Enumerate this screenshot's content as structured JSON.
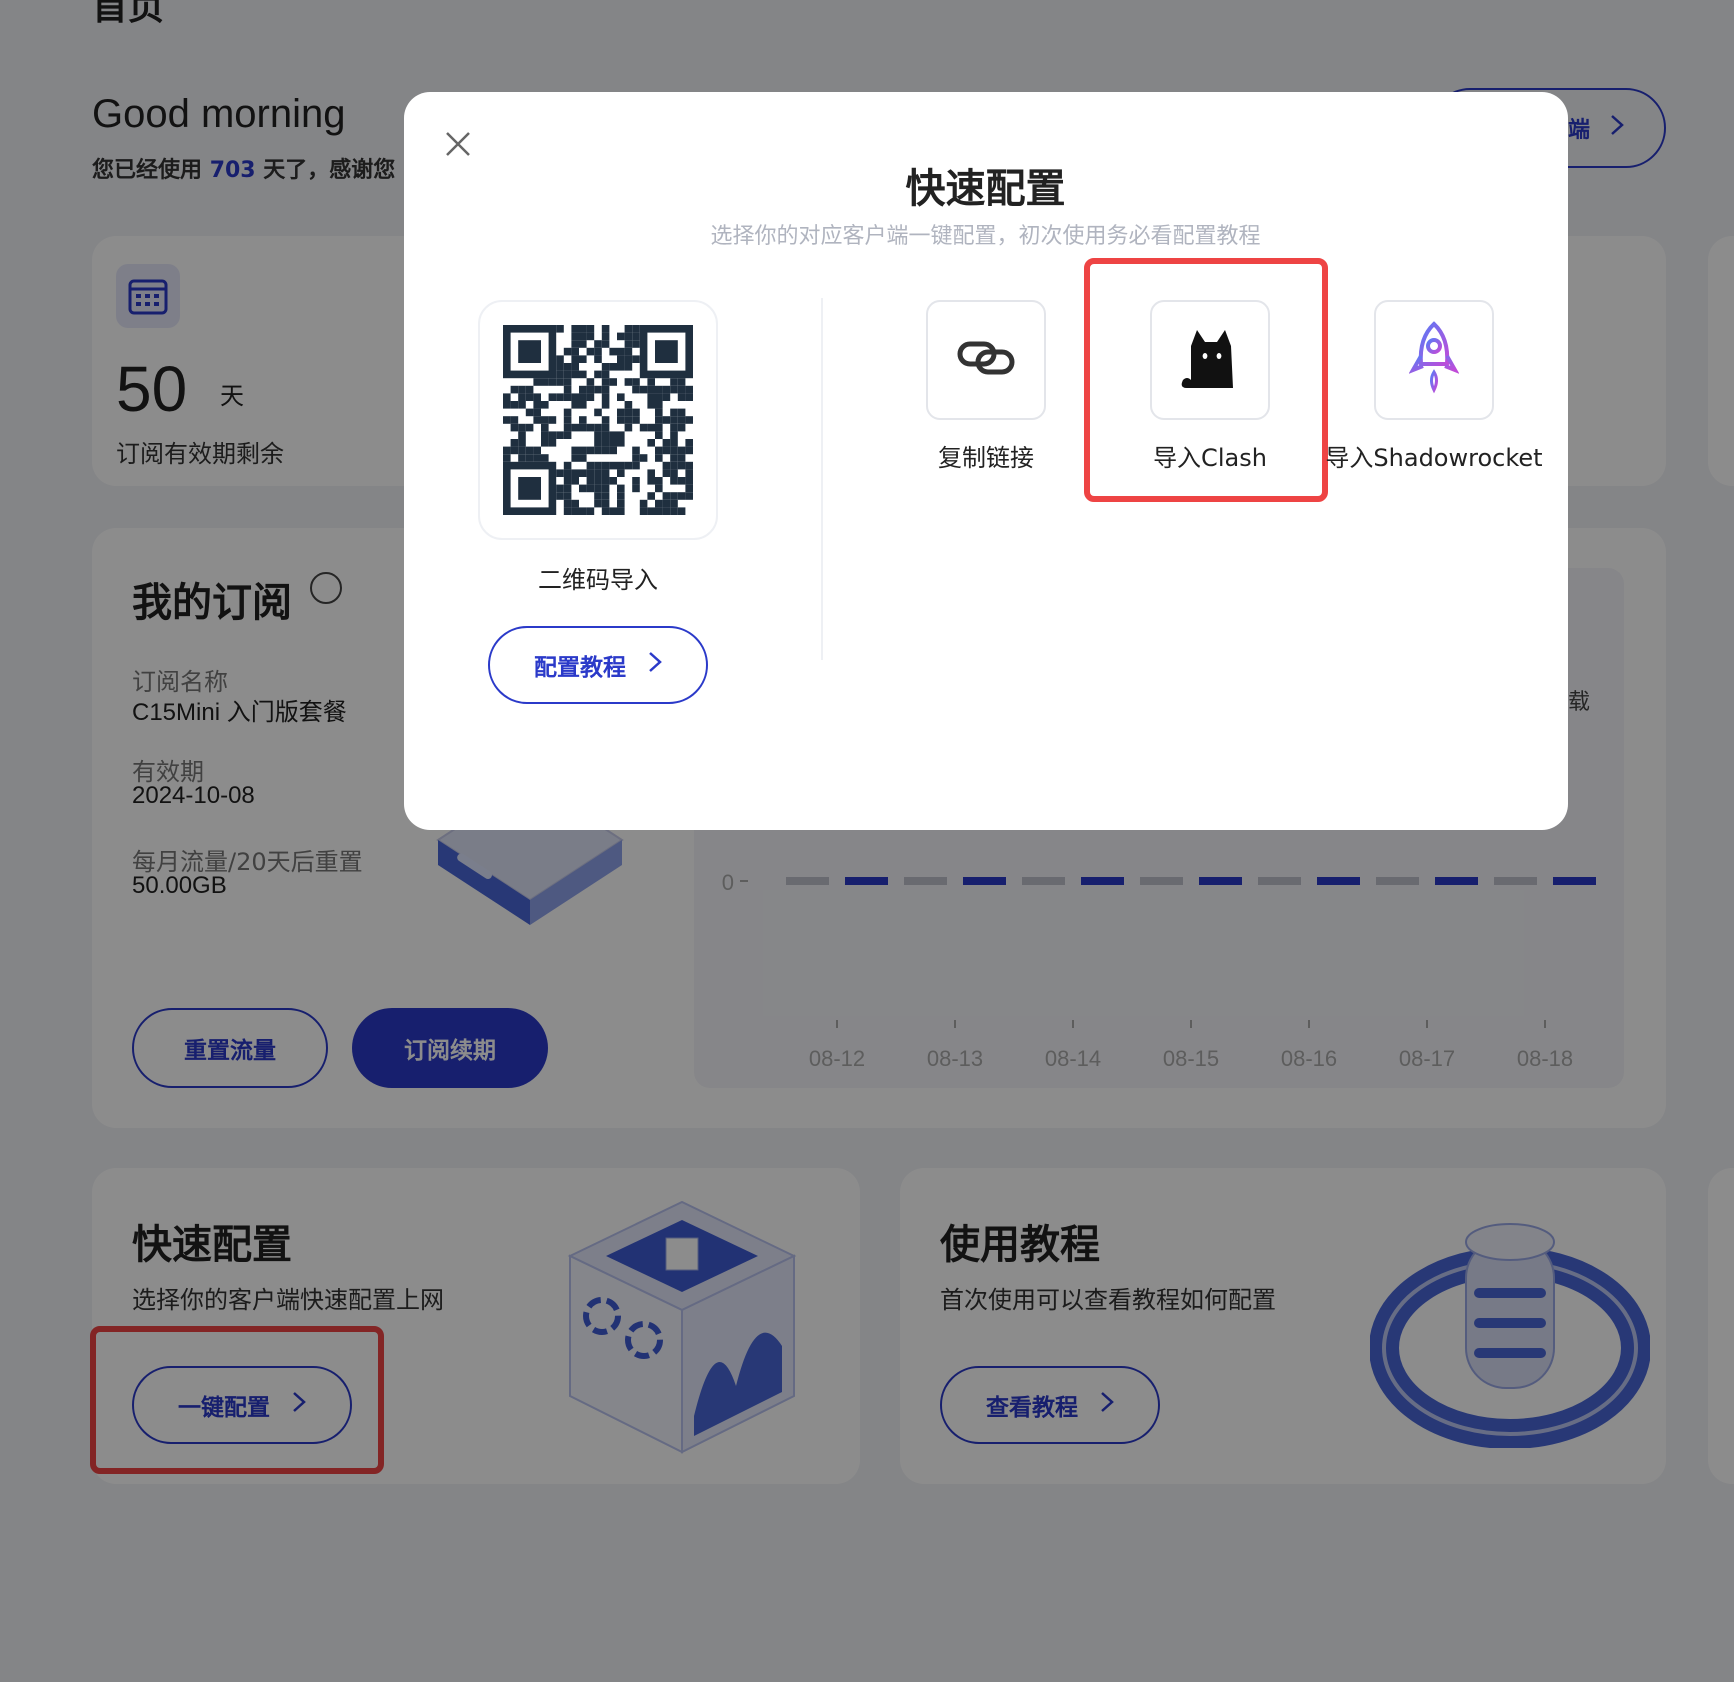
{
  "page": {
    "title": "首页",
    "greeting": "Good morning",
    "usage_prefix": "您已经使用",
    "usage_days": "703",
    "usage_suffix": "天了，感谢您",
    "client_button": "端"
  },
  "remaining": {
    "days": "50",
    "unit": "天",
    "label": "订阅有效期剩余"
  },
  "subscription": {
    "title": "我的订阅",
    "name_label": "订阅名称",
    "name_value": "C15Mini 入门版套餐",
    "expiry_label": "有效期",
    "expiry_value": "2024-10-08",
    "traffic_label": "每月流量/20天后重置",
    "traffic_value": "50.00GB",
    "reset_button": "重置流量",
    "renew_button": "订阅续期"
  },
  "traffic_chart": {
    "side_label": "载",
    "y_zero": "0"
  },
  "chart_data": {
    "type": "bar",
    "categories": [
      "08-12",
      "08-13",
      "08-14",
      "08-15",
      "08-16",
      "08-17",
      "08-18"
    ],
    "series": [
      {
        "values": [
          0,
          0,
          0,
          0,
          0,
          0,
          0
        ],
        "color": "#bfc2cc"
      },
      {
        "values": [
          0,
          0,
          0,
          0,
          0,
          0,
          0
        ],
        "color": "#2b3ac9"
      }
    ],
    "title": "",
    "xlabel": "",
    "ylabel": ""
  },
  "quick_config": {
    "title": "快速配置",
    "desc": "选择你的客户端快速配置上网",
    "button": "一键配置"
  },
  "tutorial": {
    "title": "使用教程",
    "desc": "首次使用可以查看教程如何配置",
    "button": "查看教程"
  },
  "modal": {
    "title": "快速配置",
    "subtitle": "选择你的对应客户端一键配置，初次使用务必看配置教程",
    "qr_label": "二维码导入",
    "tutorial_button": "配置教程",
    "options": [
      {
        "label": "复制链接",
        "icon": "link-icon"
      },
      {
        "label": "导入Clash",
        "icon": "clash-cat-icon"
      },
      {
        "label": "导入Shadowrocket",
        "icon": "rocket-icon"
      }
    ]
  },
  "colors": {
    "accent": "#2b3ac9",
    "highlight": "#ee4444",
    "overlay": "rgba(0,0,0,0.45)"
  }
}
